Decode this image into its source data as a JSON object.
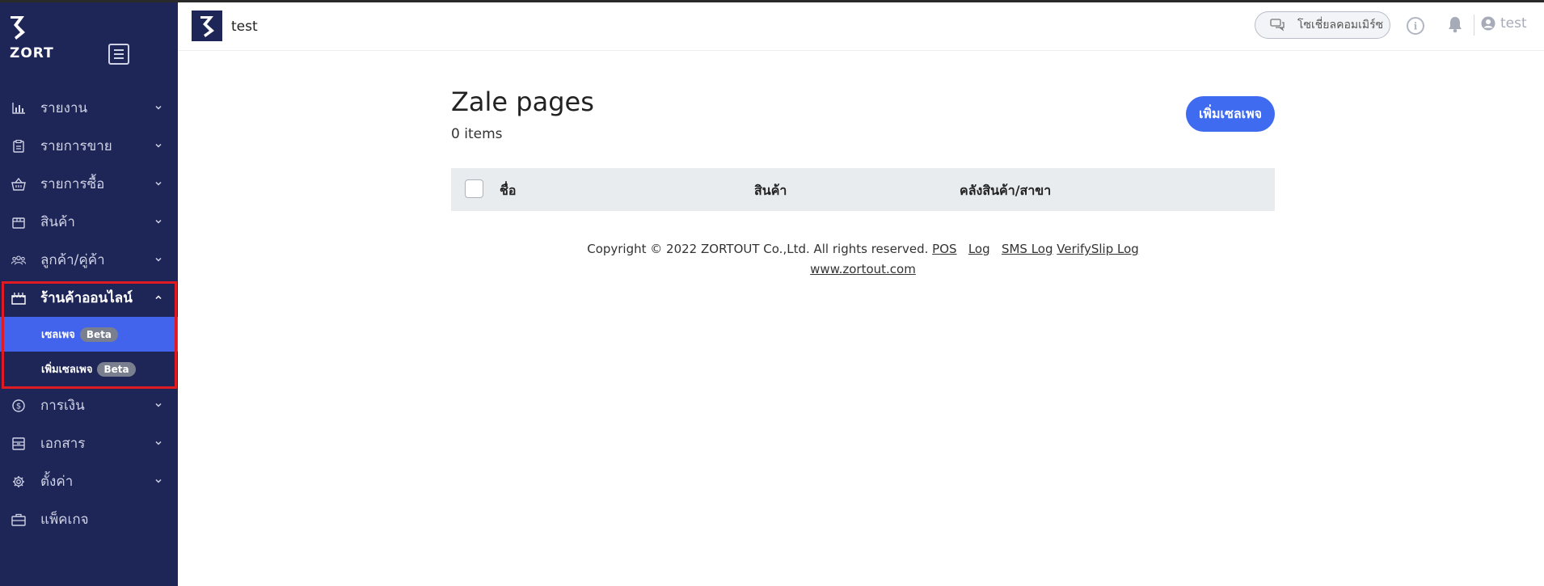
{
  "brand": {
    "name": "ZORT"
  },
  "sidebar": {
    "items": [
      {
        "label": "รายงาน",
        "icon": "bar-chart-icon"
      },
      {
        "label": "รายการขาย",
        "icon": "clipboard-icon"
      },
      {
        "label": "รายการซื้อ",
        "icon": "basket-icon"
      },
      {
        "label": "สินค้า",
        "icon": "box-icon"
      },
      {
        "label": "ลูกค้า/คู่ค้า",
        "icon": "people-icon"
      },
      {
        "label": "ร้านค้าออนไลน์",
        "icon": "store-icon"
      },
      {
        "label": "การเงิน",
        "icon": "dollar-circle-icon"
      },
      {
        "label": "เอกสาร",
        "icon": "document-icon"
      },
      {
        "label": "ตั้งค่า",
        "icon": "gear-icon"
      },
      {
        "label": "แพ็คเกจ",
        "icon": "briefcase-icon"
      }
    ],
    "online_store_sub": [
      {
        "label": "เซลเพจ",
        "badge": "Beta"
      },
      {
        "label": "เพิ่มเซลเพจ",
        "badge": "Beta"
      }
    ]
  },
  "topbar": {
    "shop_name": "test",
    "social_commerce_label": "โซเชี่ยลคอมเมิร์ซ",
    "user_label": "test"
  },
  "main": {
    "title": "Zale pages",
    "count": "0 items",
    "add_button": "เพิ่มเซลเพจ",
    "columns": [
      "ชื่อ",
      "สินค้า",
      "คลังสินค้า/สาขา"
    ]
  },
  "footer": {
    "copyright": "Copyright © 2022 ZORTOUT Co.,Ltd. All rights reserved.",
    "links": [
      "POS",
      "Log",
      "SMS Log",
      "VerifySlip Log"
    ],
    "site": "www.zortout.com"
  },
  "colors": {
    "sidebar_bg": "#1e2557",
    "accent": "#4263eb",
    "button": "#3f6bf0",
    "highlight_border": "#e01a22"
  }
}
